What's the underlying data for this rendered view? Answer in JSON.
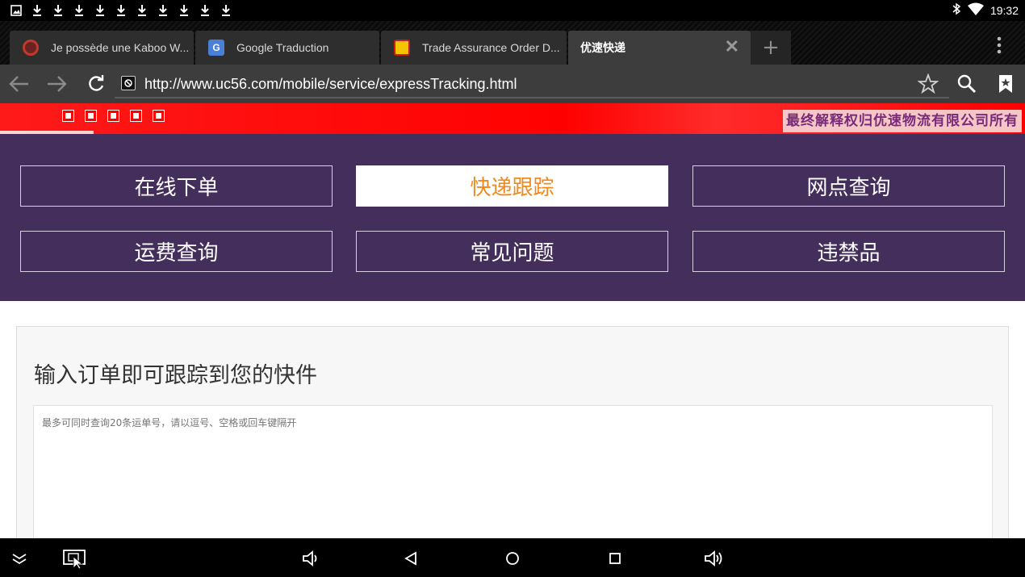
{
  "status_bar": {
    "time": "19:32",
    "left_icons": [
      "image-icon",
      "download-icon",
      "download-icon",
      "download-icon",
      "download-icon",
      "download-icon",
      "download-icon",
      "download-icon",
      "download-icon",
      "download-icon",
      "download-icon"
    ],
    "right_icons": [
      "bluetooth-icon",
      "wifi-icon"
    ]
  },
  "tabs": [
    {
      "title": "Je possède une Kaboo W...",
      "favicon_color": "#c0392b"
    },
    {
      "title": "Google Traduction",
      "favicon_color": "#4a7fd8"
    },
    {
      "title": "Trade Assurance Order D...",
      "favicon_color": "#f5c400"
    },
    {
      "title": "优速快递",
      "favicon_color": ""
    }
  ],
  "toolbar": {
    "url": "http://www.uc56.com/mobile/service/expressTracking.html"
  },
  "banner": {
    "notice": "最终解释权归优速物流有限公司所有"
  },
  "nav_menu": [
    {
      "label": "在线下单",
      "active": false
    },
    {
      "label": "快递跟踪",
      "active": true
    },
    {
      "label": "网点查询",
      "active": false
    },
    {
      "label": "运费查询",
      "active": false
    },
    {
      "label": "常见问题",
      "active": false
    },
    {
      "label": "违禁品",
      "active": false
    }
  ],
  "tracking": {
    "title": "输入订单即可跟踪到您的快件",
    "placeholder": "最多可同时查询20条运单号，请以逗号、空格或回车键隔开",
    "value": ""
  },
  "colors": {
    "nav_bg": "#442f5c",
    "active_text": "#f08a1c",
    "banner_red": "#ff0000"
  }
}
